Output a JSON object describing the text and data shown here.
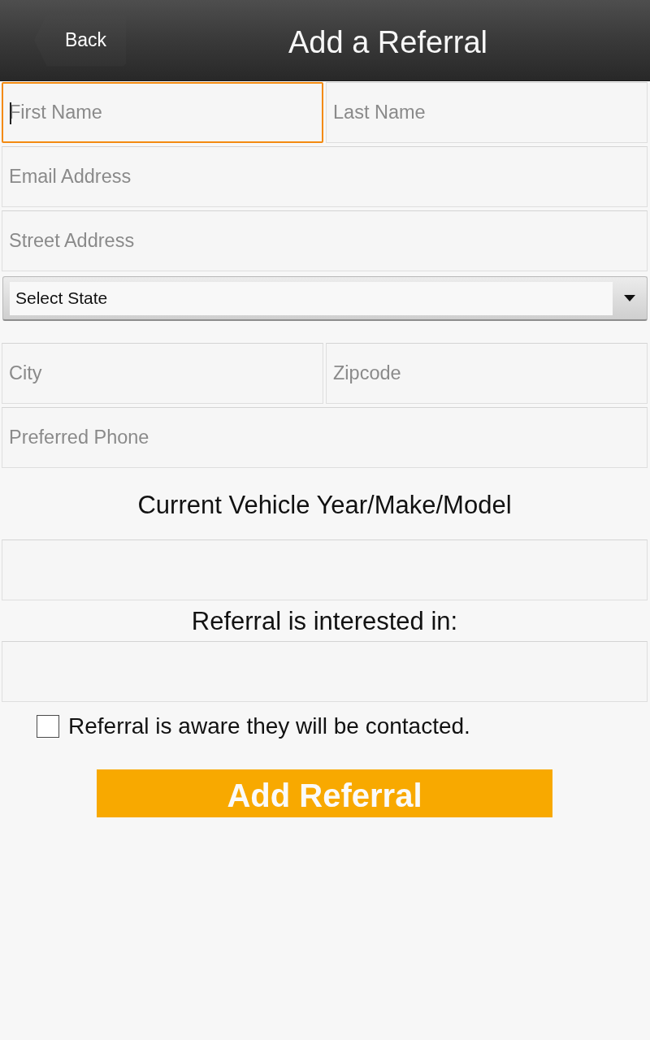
{
  "header": {
    "back_button": "Back",
    "title": "Add a Referral"
  },
  "form": [
    {
      "kind": "inputs",
      "fields": [
        {
          "placeholder": "First Name",
          "focused": true
        },
        {
          "placeholder": "Last Name",
          "focused": false
        }
      ]
    },
    {
      "kind": "inputs",
      "fields": [
        {
          "placeholder": "Email Address",
          "focused": false
        }
      ]
    },
    {
      "kind": "inputs",
      "fields": [
        {
          "placeholder": "Street Address",
          "focused": false
        }
      ]
    },
    {
      "kind": "select",
      "value": "Select State"
    },
    {
      "kind": "inputs",
      "fields": [
        {
          "placeholder": "City",
          "focused": false
        },
        {
          "placeholder": "Zipcode",
          "focused": false
        }
      ]
    },
    {
      "kind": "inputs",
      "fields": [
        {
          "placeholder": "Preferred Phone",
          "focused": false
        }
      ]
    },
    {
      "kind": "heading",
      "text": "Current Vehicle Year/Make/Model"
    },
    {
      "kind": "inputs",
      "fields": [
        {
          "focused": false
        }
      ]
    },
    {
      "kind": "heading",
      "text": "Referral is interested in:"
    },
    {
      "kind": "inputs",
      "fields": [
        {
          "focused": false
        }
      ]
    },
    {
      "kind": "checkbox",
      "label": "Referral is aware they will be contacted.",
      "checked": false
    },
    {
      "kind": "submit",
      "label": "Add Referral"
    }
  ]
}
